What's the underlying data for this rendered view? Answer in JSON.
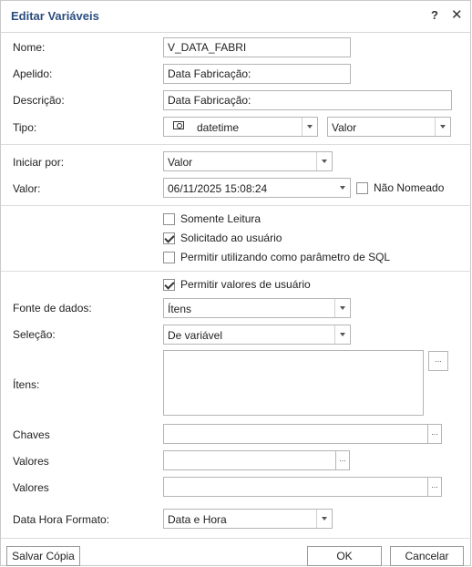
{
  "dialog": {
    "title": "Editar Variáveis",
    "help": "?",
    "close": "✕"
  },
  "fields": {
    "nome": {
      "label": "Nome:",
      "value": "V_DATA_FABRI"
    },
    "apelido": {
      "label": "Apelido:",
      "value": "Data Fabricação:"
    },
    "descricao": {
      "label": "Descrição:",
      "value": "Data Fabricação:"
    },
    "tipo": {
      "label": "Tipo:",
      "type_value": "datetime",
      "mode_value": "Valor"
    },
    "iniciar_por": {
      "label": "Iniciar por:",
      "value": "Valor"
    },
    "valor": {
      "label": "Valor:",
      "value": "06/11/2025 15:08:24",
      "nao_nomeado": "Não Nomeado"
    }
  },
  "options": {
    "somente_leitura": {
      "label": "Somente Leitura",
      "checked": false
    },
    "solicitado": {
      "label": "Solicitado ao usuário",
      "checked": true
    },
    "permitir_sql": {
      "label": "Permitir utilizando como parâmetro de SQL",
      "checked": false
    },
    "permitir_valores": {
      "label": "Permitir valores de usuário",
      "checked": true
    }
  },
  "data_source": {
    "fonte": {
      "label": "Fonte de dados:",
      "value": "Ítens"
    },
    "selecao": {
      "label": "Seleção:",
      "value": "De variável"
    },
    "itens": {
      "label": "Ítens:"
    },
    "chaves": {
      "label": "Chaves"
    },
    "valores1": {
      "label": "Valores"
    },
    "valores2": {
      "label": "Valores"
    },
    "data_hora": {
      "label": "Data Hora Formato:",
      "value": "Data e Hora"
    },
    "dots": "..."
  },
  "buttons": {
    "salvar_copia": "Salvar Cópia",
    "ok": "OK",
    "cancelar": "Cancelar"
  }
}
